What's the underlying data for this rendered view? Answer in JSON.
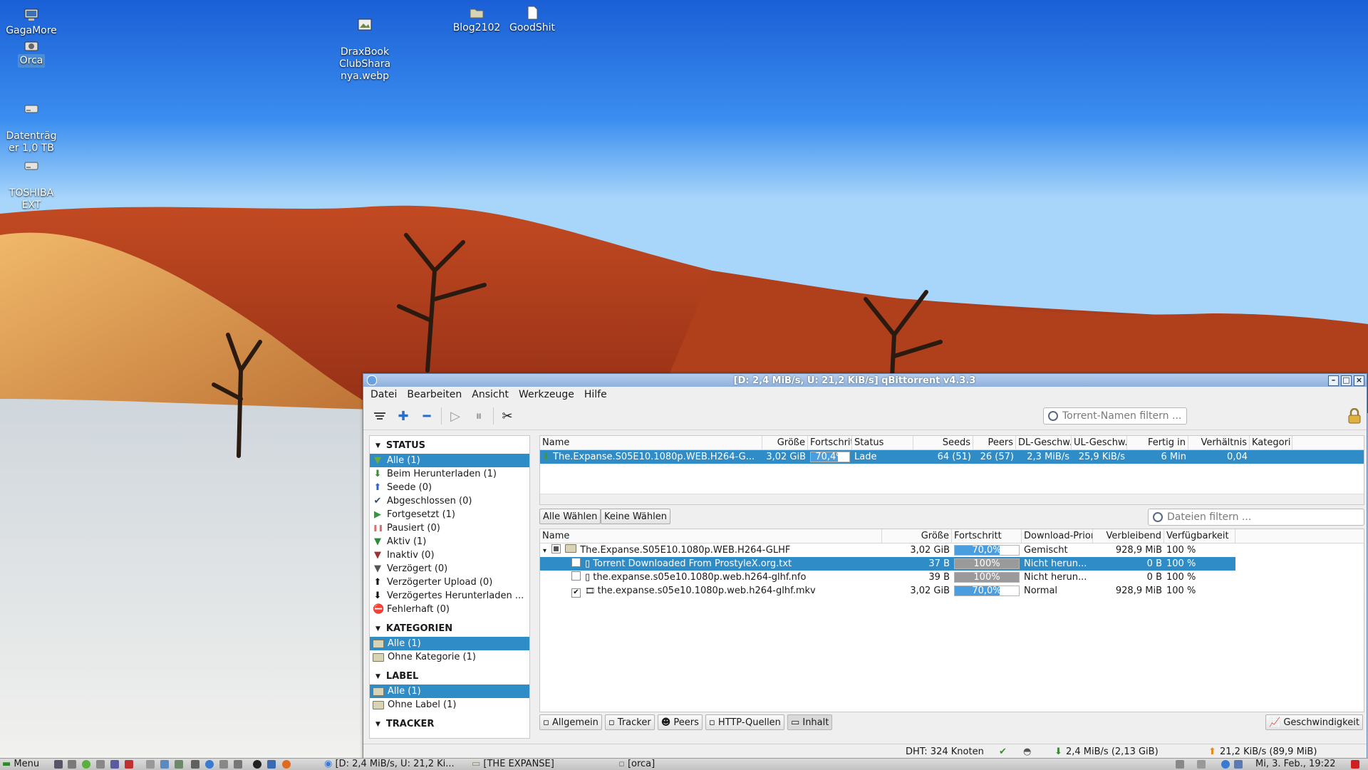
{
  "desktop": {
    "icons": [
      {
        "label": "GagaMore",
        "icon": "computer-icon"
      },
      {
        "label": "Orca",
        "icon": "camera-icon"
      },
      {
        "label": "DraxBook\nClubShara\nnya.webp",
        "icon": "image-file-icon"
      },
      {
        "label": "Blog2102",
        "icon": "folder-icon"
      },
      {
        "label": "GoodShit",
        "icon": "document-icon"
      },
      {
        "label": "Datenträg\ner 1,0 TB",
        "icon": "drive-icon"
      },
      {
        "label": "TOSHIBA\nEXT",
        "icon": "drive-icon"
      }
    ]
  },
  "window": {
    "title": "[D: 2,4 MiB/s, U: 21,2 KiB/s] qBittorrent v4.3.3",
    "menu": [
      "Datei",
      "Bearbeiten",
      "Ansicht",
      "Werkzeuge",
      "Hilfe"
    ],
    "toolbar": {
      "search_placeholder": "Torrent-Namen filtern ..."
    },
    "sidebar": {
      "status_header": "STATUS",
      "status_items": [
        {
          "label": "Alle (1)",
          "icon": "filter-icon",
          "color": "#6cae3c"
        },
        {
          "label": "Beim Herunterladen (1)",
          "icon": "download-arrow-icon",
          "color": "#3c8a3a"
        },
        {
          "label": "Seede (0)",
          "icon": "upload-arrow-icon",
          "color": "#2e65c8"
        },
        {
          "label": "Abgeschlossen (0)",
          "icon": "checkmark-icon",
          "color": "#2e4f7a"
        },
        {
          "label": "Fortgesetzt (1)",
          "icon": "play-icon",
          "color": "#2e9a3a"
        },
        {
          "label": "Pausiert (0)",
          "icon": "pause-icon",
          "color": "#e06a6a"
        },
        {
          "label": "Aktiv (1)",
          "icon": "filter-icon",
          "color": "#2e8a3a"
        },
        {
          "label": "Inaktiv (0)",
          "icon": "filter-icon",
          "color": "#a33030"
        },
        {
          "label": "Verzögert (0)",
          "icon": "filter-icon",
          "color": "#555555"
        },
        {
          "label": "Verzögerter Upload (0)",
          "icon": "upload-arrow-icon",
          "color": "#111111"
        },
        {
          "label": "Verzögertes Herunterladen ...",
          "icon": "download-arrow-icon",
          "color": "#111111"
        },
        {
          "label": "Fehlerhaft (0)",
          "icon": "error-icon",
          "color": "#d42020"
        }
      ],
      "categories_header": "KATEGORIEN",
      "categories_items": [
        "Alle (1)",
        "Ohne Kategorie (1)"
      ],
      "label_header": "LABEL",
      "label_items": [
        "Alle (1)",
        "Ohne Label (1)"
      ],
      "tracker_header": "TRACKER"
    },
    "torrents": {
      "columns": [
        "Name",
        "Größe",
        "Fortschritt",
        "Status",
        "Seeds",
        "Peers",
        "DL-Geschw.",
        "UL-Geschw.",
        "Fertig in",
        "Verhältnis",
        "Kategori"
      ],
      "rows": [
        {
          "name": "The.Expanse.S05E10.1080p.WEB.H264-G...",
          "size": "3,02 GiB",
          "progress_label": "70,4%",
          "progress": 0.704,
          "status": "Lade",
          "seeds": "64 (51)",
          "peers": "26 (57)",
          "dl": "2,3 MiB/s",
          "ul": "25,9 KiB/s",
          "eta": "6 Min",
          "ratio": "0,04",
          "category": ""
        }
      ]
    },
    "content": {
      "select_all": "Alle Wählen",
      "select_none": "Keine Wählen",
      "filter_placeholder": "Dateien filtern ...",
      "columns": [
        "Name",
        "Größe",
        "Fortschritt",
        "Download-Prior",
        "Verbleibend",
        "Verfügbarkeit"
      ],
      "rows": [
        {
          "name": "The.Expanse.S05E10.1080p.WEB.H264-GLHF",
          "type": "folder",
          "check": "partial",
          "size": "3,02 GiB",
          "progress_label": "70,0%",
          "progress": 0.7,
          "priority": "Gemischt",
          "remaining": "928,9 MiB",
          "availability": "100 %"
        },
        {
          "name": "Torrent Downloaded From ProstyleX.org.txt",
          "type": "file",
          "check": "unchecked",
          "size": "37 B",
          "progress_label": "100%",
          "progress": 1.0,
          "priority": "Nicht herun...",
          "remaining": "0 B",
          "availability": "100 %"
        },
        {
          "name": "the.expanse.s05e10.1080p.web.h264-glhf.nfo",
          "type": "file",
          "check": "unchecked",
          "size": "39 B",
          "progress_label": "100%",
          "progress": 1.0,
          "priority": "Nicht herun...",
          "remaining": "0 B",
          "availability": "100 %"
        },
        {
          "name": "the.expanse.s05e10.1080p.web.h264-glhf.mkv",
          "type": "video",
          "check": "checked",
          "size": "3,02 GiB",
          "progress_label": "70,0%",
          "progress": 0.7,
          "priority": "Normal",
          "remaining": "928,9 MiB",
          "availability": "100 %"
        }
      ]
    },
    "tabs": [
      "Allgemein",
      "Tracker",
      "Peers",
      "HTTP-Quellen",
      "Inhalt"
    ],
    "speed_button": "Geschwindigkeit",
    "statusbar": {
      "dht": "DHT: 324 Knoten",
      "download": "2,4 MiB/s (2,13 GiB)",
      "upload": "21,2 KiB/s (89,9 MiB)"
    }
  },
  "taskbar": {
    "menu_label": "Menu",
    "tasks": [
      "[D: 2,4 MiB/s, U: 21,2 Ki...",
      "[THE EXPANSE]",
      "[orca]"
    ],
    "clock": "Mi, 3. Feb., 19:22"
  },
  "colors": {
    "selection": "#308cc6",
    "progress_fill": "#4a9ee0"
  }
}
